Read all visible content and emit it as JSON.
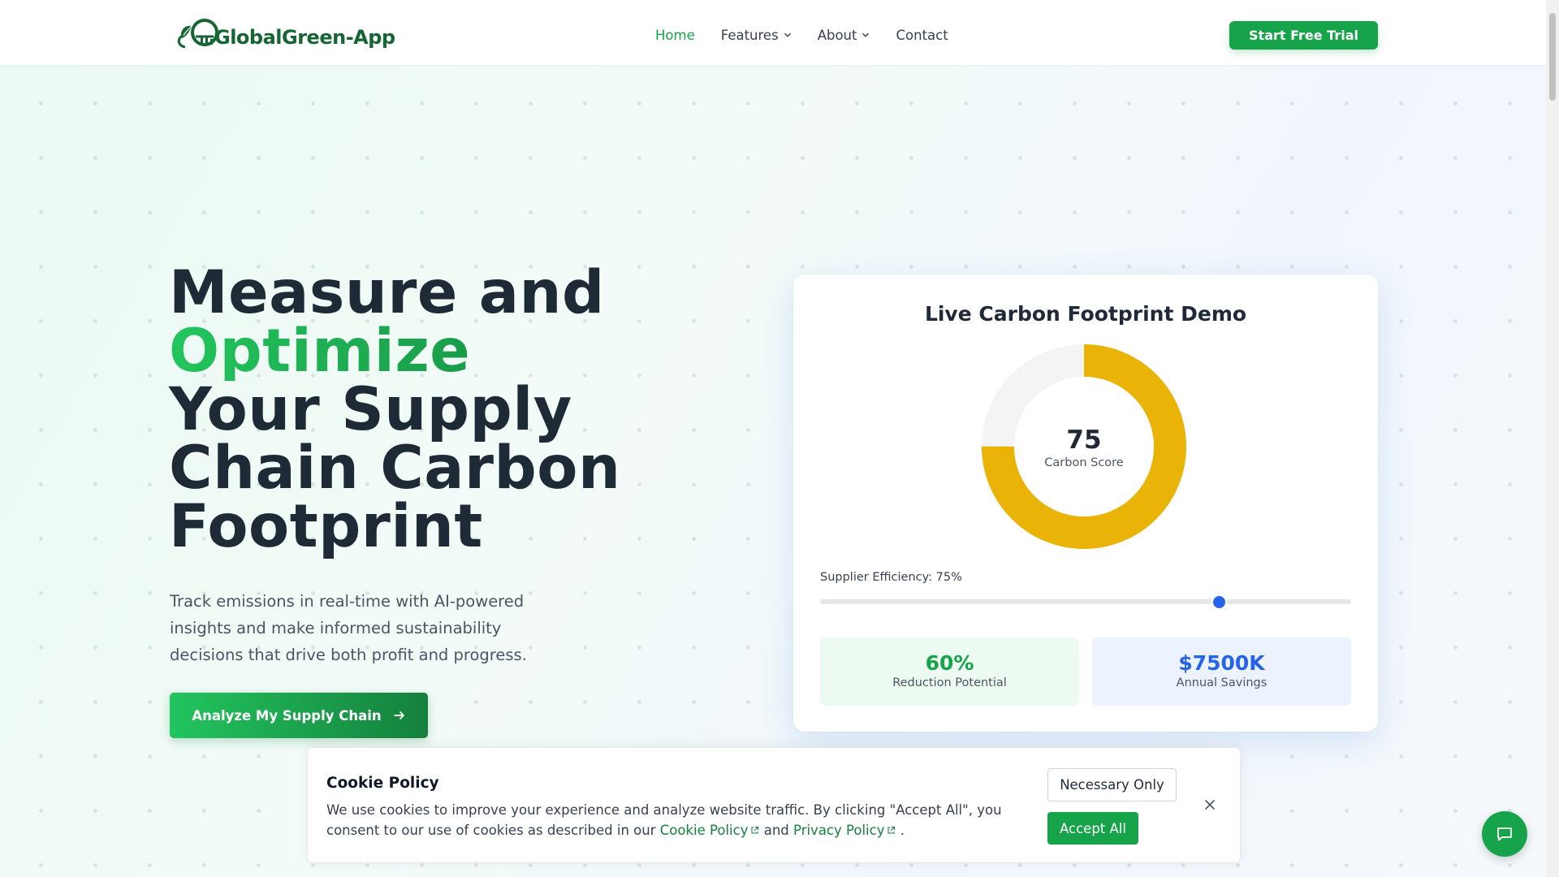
{
  "header": {
    "logo_text": "GlobalGreen-App",
    "nav": [
      {
        "label": "Home",
        "active": true
      },
      {
        "label": "Features",
        "dropdown": true
      },
      {
        "label": "About",
        "dropdown": true
      },
      {
        "label": "Contact"
      }
    ],
    "cta_label": "Start Free Trial"
  },
  "hero": {
    "title_line1": "Measure and",
    "title_accent": "Optimize",
    "title_line3": "Your Supply",
    "title_line4": "Chain Carbon",
    "title_line5": "Footprint",
    "subtitle": "Track emissions in real-time with AI-powered insights and make informed sustainability decisions that drive both profit and progress.",
    "cta_label": "Analyze My Supply Chain"
  },
  "demo": {
    "title": "Live Carbon Footprint Demo",
    "score_value": "75",
    "score_max": 100,
    "score_label": "Carbon Score",
    "slider_label": "Supplier Efficiency: 75%",
    "slider_fraction": 0.75,
    "stats": [
      {
        "value": "60%",
        "label": "Reduction Potential"
      },
      {
        "value": "$7500K",
        "label": "Annual Savings"
      }
    ],
    "colors": {
      "ring": "#eab308",
      "ring_track": "#f3f4f6",
      "green": "#16a34a",
      "blue": "#2563eb"
    }
  },
  "cookie": {
    "title": "Cookie Policy",
    "text_before": "We use cookies to improve your experience and analyze website traffic. By clicking \"Accept All\", you consent to our use of cookies as described in our",
    "cookie_link": "Cookie Policy",
    "and": "and",
    "privacy_link": "Privacy Policy",
    "period": ".",
    "necessary_label": "Necessary Only",
    "accept_label": "Accept All"
  },
  "icons": {
    "chevron": "chevron-down-icon",
    "arrow": "arrow-right-icon",
    "external": "external-link-icon",
    "close": "close-icon",
    "chat": "chat-bubble-icon"
  }
}
